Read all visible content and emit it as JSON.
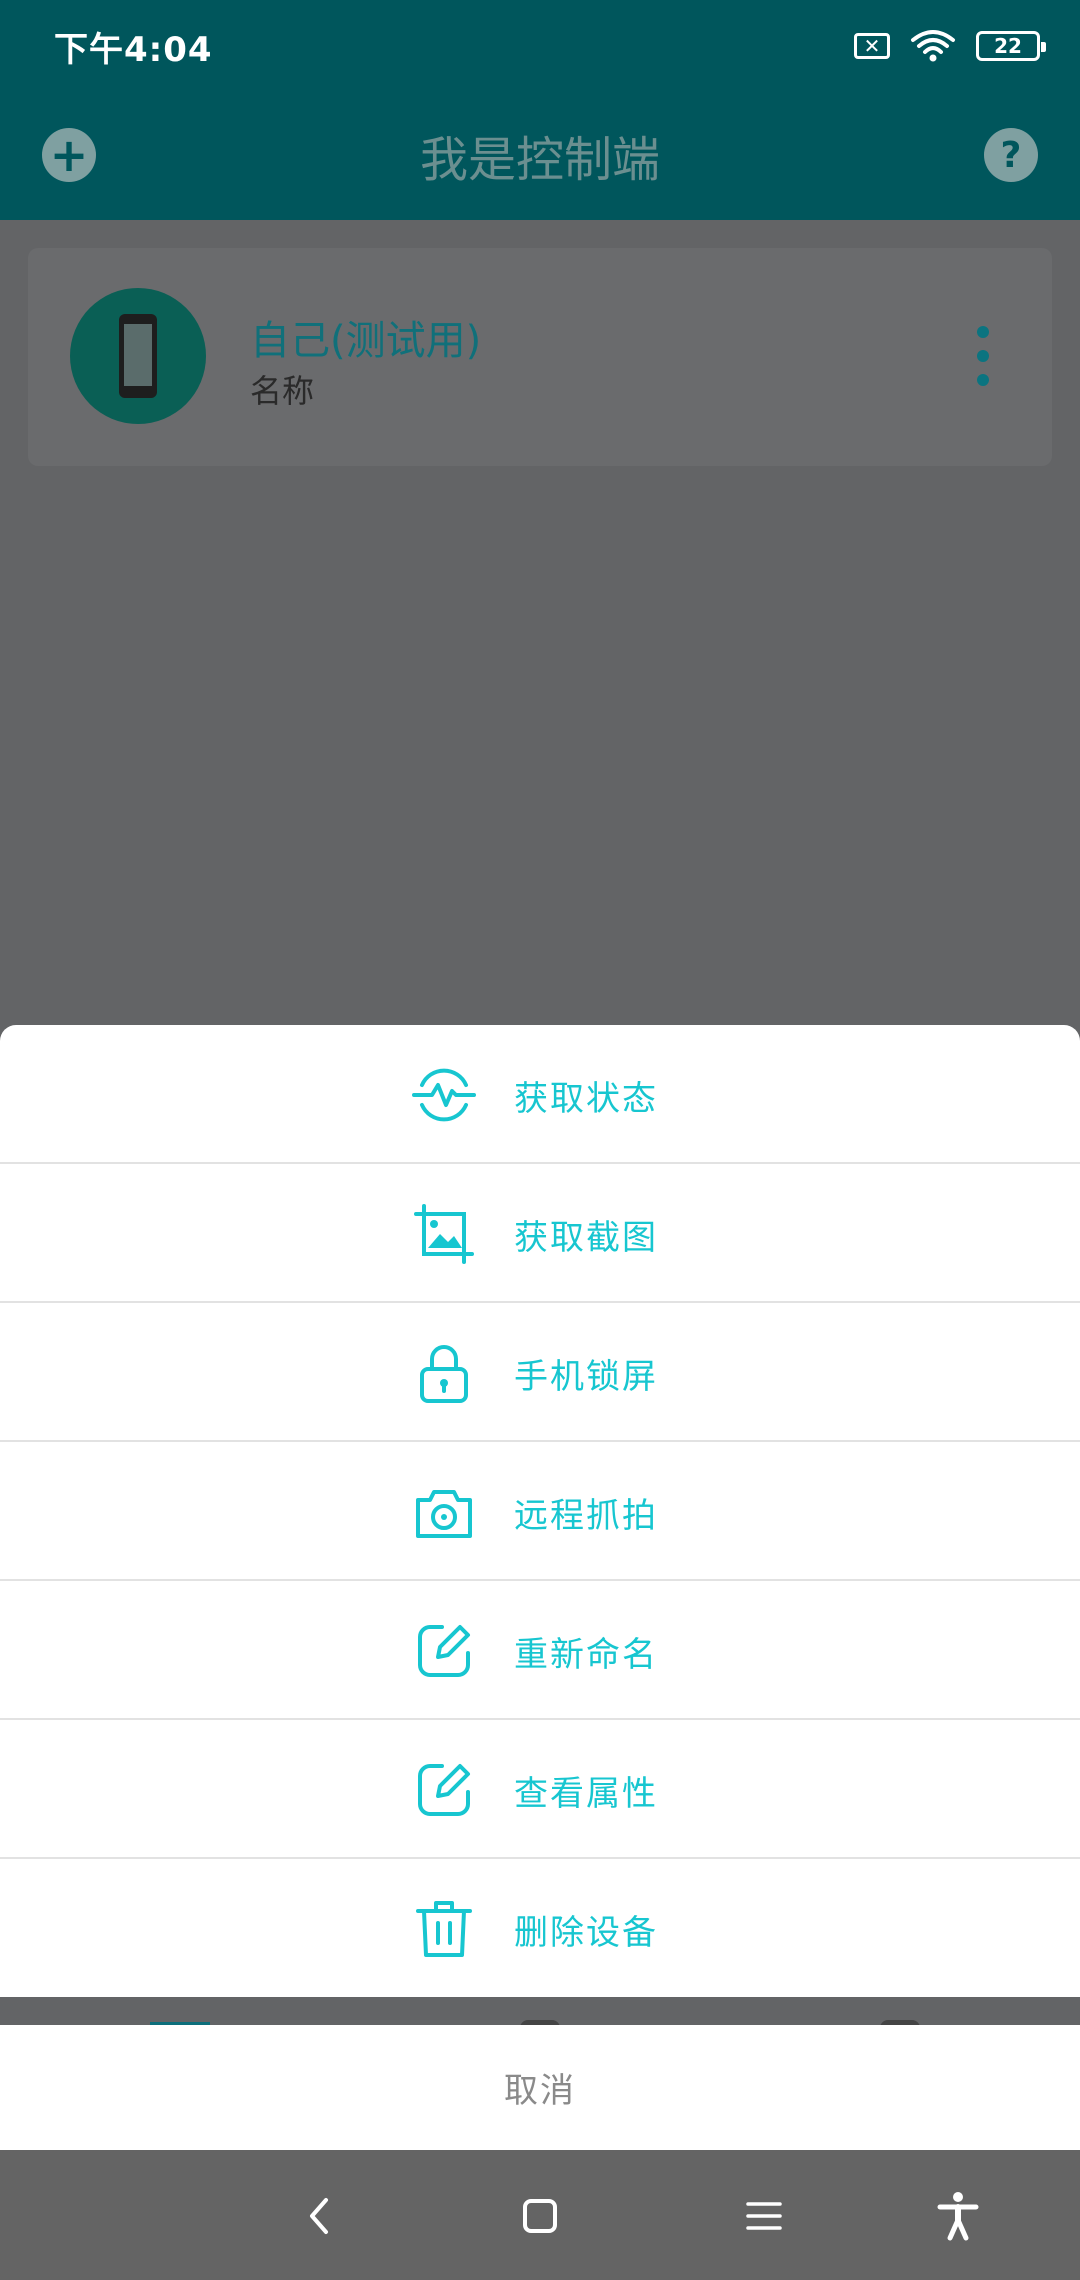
{
  "status_bar": {
    "time": "下午4:04",
    "battery": "22",
    "sim_icon": "sim-x-icon",
    "wifi_icon": "wifi-icon"
  },
  "app_bar": {
    "title": "我是控制端",
    "left_icon": "add-circle-icon",
    "right_icon": "help-circle-icon"
  },
  "device": {
    "name": "自己(测试用)",
    "subtitle": "名称",
    "avatar_icon": "phone-icon",
    "menu_icon": "more-vertical-icon"
  },
  "sheet": {
    "accent_color": "#17c6d0",
    "items": [
      {
        "label": "获取状态",
        "icon": "pulse-icon"
      },
      {
        "label": "获取截图",
        "icon": "image-crop-icon"
      },
      {
        "label": "手机锁屏",
        "icon": "lock-icon"
      },
      {
        "label": "远程抓拍",
        "icon": "camera-icon"
      },
      {
        "label": "重新命名",
        "icon": "edit-icon"
      },
      {
        "label": "查看属性",
        "icon": "edit-icon"
      },
      {
        "label": "删除设备",
        "icon": "trash-icon"
      }
    ],
    "cancel_label": "取消"
  },
  "colors": {
    "primary": "#00565C",
    "overlay": "#636466",
    "nav": "#646464"
  }
}
